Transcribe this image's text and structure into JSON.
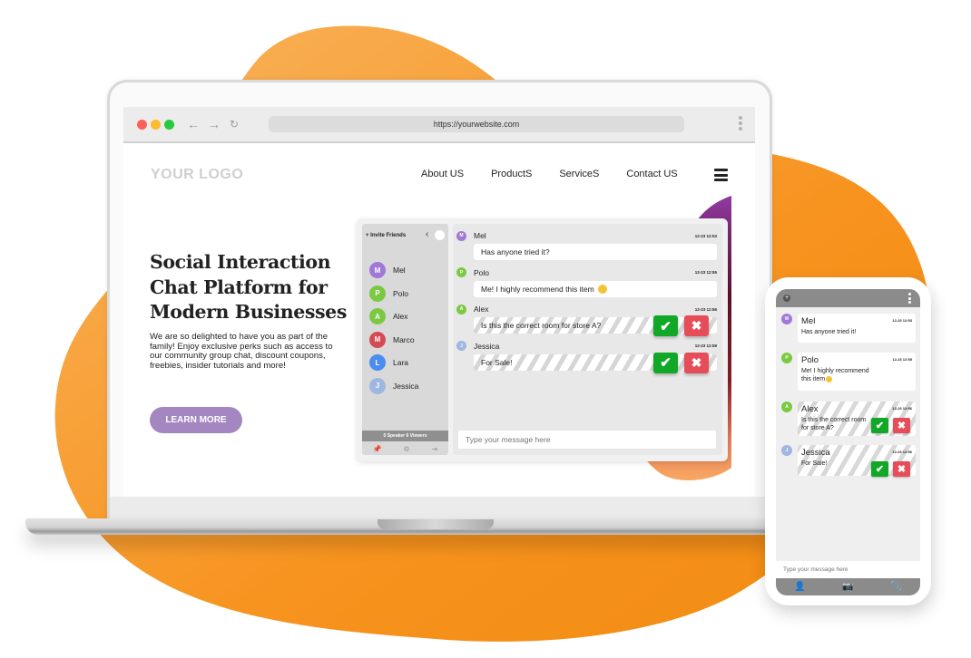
{
  "colors": {
    "background_blob": "#f7931e",
    "accent_purple": "#a487c0",
    "approve_green": "#10a826",
    "reject_red": "#e64d59"
  },
  "browser": {
    "url": "https://yourwebsite.com",
    "icons": {
      "back": "arrow-left-icon",
      "forward": "arrow-right-icon",
      "reload": "reload-icon",
      "menu": "kebab-menu-icon"
    }
  },
  "site": {
    "logo": "YOUR LOGO",
    "nav": [
      "About US",
      "ProductS",
      "ServiceS",
      "Contact US"
    ],
    "menu_icon": "hamburger-icon"
  },
  "hero": {
    "title_lines": [
      "Social Interaction",
      "Chat Platform for",
      "Modern Businesses"
    ],
    "body": "We are so delighted to have you as part of the family! Enjoy exclusive perks such as access to our community group chat, discount coupons, freebies, insider tutorials and more!",
    "cta": "LEARN MORE"
  },
  "chat": {
    "sidebar": {
      "invite": "+ Invite Friends",
      "collapse_icon": "chevron-left-icon",
      "search_icon": "search-icon",
      "members": [
        {
          "initial": "M",
          "name": "Mel",
          "color": "#a079d6"
        },
        {
          "initial": "P",
          "name": "Polo",
          "color": "#7bc943"
        },
        {
          "initial": "A",
          "name": "Alex",
          "color": "#7bc943"
        },
        {
          "initial": "M",
          "name": "Marco",
          "color": "#d44a55"
        },
        {
          "initial": "L",
          "name": "Lara",
          "color": "#4a8cf0"
        },
        {
          "initial": "J",
          "name": "Jessica",
          "color": "#9fb7e0"
        }
      ],
      "footer": "0 Speaker 6 Viewers",
      "tools": [
        "pin-icon",
        "gear-icon",
        "exit-icon"
      ]
    },
    "messages": [
      {
        "initial": "M",
        "name": "Mel",
        "color": "#a079d6",
        "time": "12-23 12:53",
        "text": "Has anyone tried it?",
        "pending": false,
        "emoji": false
      },
      {
        "initial": "P",
        "name": "Polo",
        "color": "#7bc943",
        "time": "12-23 12:55",
        "text": "Me! I highly recommend this item",
        "pending": false,
        "emoji": true
      },
      {
        "initial": "A",
        "name": "Alex",
        "color": "#7bc943",
        "time": "12-23 12:56",
        "text": "Is this the correct room for store A?",
        "pending": true,
        "emoji": false
      },
      {
        "initial": "J",
        "name": "Jessica",
        "color": "#9fb7e0",
        "time": "12-23 12:59",
        "text": "For Sale!",
        "pending": true,
        "emoji": false
      }
    ],
    "approve_glyph": "✔",
    "reject_glyph": "✖",
    "compose_placeholder": "Type your message here"
  },
  "phone": {
    "messages": [
      {
        "initial": "M",
        "name": "Mel",
        "color": "#a079d6",
        "time": "12-23 12:53",
        "text": "Has anyone tried it!",
        "pending": false
      },
      {
        "initial": "P",
        "name": "Polo",
        "color": "#7bc943",
        "time": "12-23 12:55",
        "text": "Me! I highly recommend this item",
        "pending": false
      },
      {
        "initial": "A",
        "name": "Alex",
        "color": "#7bc943",
        "time": "12-23 12:56",
        "text": "Is this the correct room for store A?",
        "pending": true
      },
      {
        "initial": "J",
        "name": "Jessica",
        "color": "#9fb7e0",
        "time": "12-23 12:56",
        "text": "For Sale!",
        "pending": true
      }
    ],
    "compose_placeholder": "Type your message here",
    "footer_icons": [
      "user-icon",
      "camera-icon",
      "paperclip-icon"
    ]
  }
}
